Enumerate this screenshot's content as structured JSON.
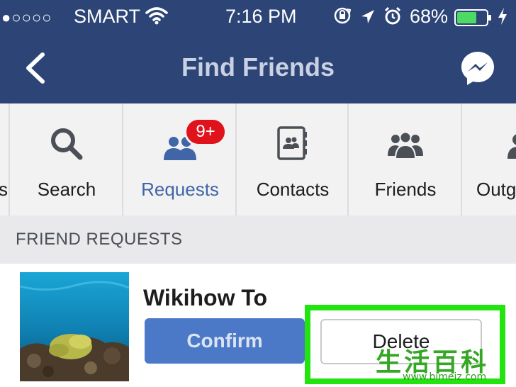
{
  "status_bar": {
    "signal": "●○○○○",
    "carrier": "SMART",
    "time": "7:16 PM",
    "battery_percent": "68%",
    "battery_level": 0.68,
    "battery_color": "#4cd964",
    "icons": [
      "wifi-icon",
      "rotation-lock-icon",
      "location-arrow-icon",
      "alarm-icon",
      "battery-icon",
      "charging-bolt-icon"
    ]
  },
  "nav": {
    "title": "Find Friends",
    "back_icon": "chevron-left-icon",
    "right_icon": "messenger-icon",
    "background": "#2c4476"
  },
  "tabs": [
    {
      "label": "s",
      "icon": ""
    },
    {
      "label": "Search",
      "icon": "search-icon"
    },
    {
      "label": "Requests",
      "icon": "requests-people-icon",
      "active": true,
      "badge": "9+"
    },
    {
      "label": "Contacts",
      "icon": "contacts-book-icon"
    },
    {
      "label": "Friends",
      "icon": "friends-group-icon"
    },
    {
      "label": "Outg",
      "icon": "person-icon"
    }
  ],
  "section": {
    "title": "FRIEND REQUESTS"
  },
  "request": {
    "name": "Wikihow To",
    "confirm_label": "Confirm",
    "delete_label": "Delete",
    "accent": "#4c79c7",
    "highlight_color": "#22e40f"
  },
  "watermark": {
    "chars": "生活百科",
    "url": "www.bimeiz.com"
  }
}
